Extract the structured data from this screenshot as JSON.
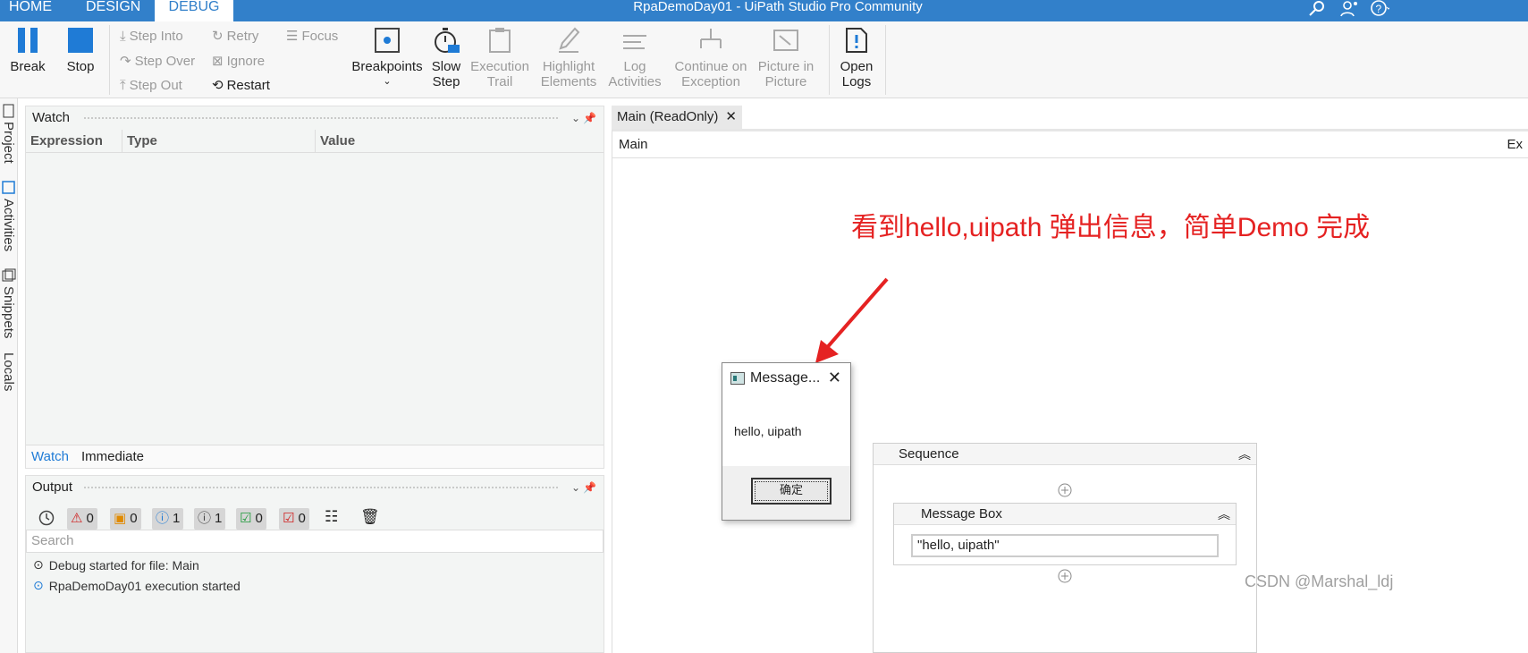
{
  "tabs": {
    "home": "HOME",
    "design": "DESIGN",
    "debug": "DEBUG"
  },
  "app_title": "RpaDemoDay01 - UiPath Studio Pro Community",
  "ribbon": {
    "break": "Break",
    "stop": "Stop",
    "step_into": "Step Into",
    "step_over": "Step Over",
    "step_out": "Step Out",
    "retry": "Retry",
    "ignore": "Ignore",
    "restart": "Restart",
    "focus": "Focus",
    "breakpoints": "Breakpoints",
    "slow_step_1": "Slow",
    "slow_step_2": "Step",
    "exec_trail_1": "Execution",
    "exec_trail_2": "Trail",
    "highlight_1": "Highlight",
    "highlight_2": "Elements",
    "log_act_1": "Log",
    "log_act_2": "Activities",
    "continue_1": "Continue on",
    "continue_2": "Exception",
    "pip_1": "Picture in",
    "pip_2": "Picture",
    "open_logs_1": "Open",
    "open_logs_2": "Logs"
  },
  "side_labels": {
    "project": "Project",
    "activities": "Activities",
    "snippets": "Snippets",
    "locals": "Locals"
  },
  "watch": {
    "title": "Watch",
    "columns": [
      "Expression",
      "Type",
      "Value"
    ],
    "tab_watch": "Watch",
    "tab_immediate": "Immediate"
  },
  "output": {
    "title": "Output",
    "counts": {
      "errors": "0",
      "warnings": "0",
      "info": "1",
      "trace": "1",
      "success": "0",
      "verbose": "0"
    },
    "search_placeholder": "Search",
    "lines": [
      "Debug started for file: Main",
      "RpaDemoDay01 execution started"
    ]
  },
  "doc_tab": "Main (ReadOnly)",
  "breadcrumb": "Main",
  "breadcrumb_right": "Ex",
  "annotation": "看到hello,uipath 弹出信息，简单Demo 完成",
  "dialog": {
    "title": "Message...",
    "message": "hello, uipath",
    "ok": "确定"
  },
  "sequence": {
    "title": "Sequence",
    "activity": "Message Box",
    "value": "\"hello, uipath\""
  },
  "watermark": "CSDN @Marshal_ldj",
  "colors": {
    "title_bar": "#3280ca",
    "accent_blue": "#1f7bd6",
    "annotation_red": "#e52222"
  }
}
